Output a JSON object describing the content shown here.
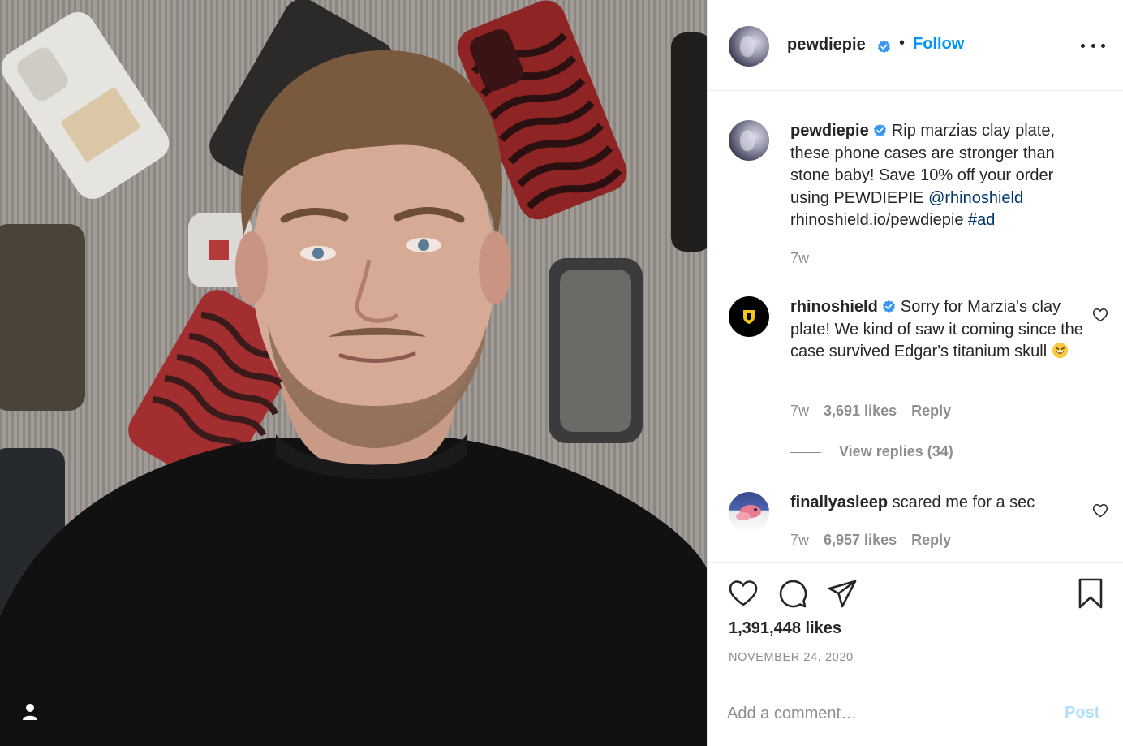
{
  "post": {
    "username": "pewdiepie",
    "follow_label": "Follow",
    "separator": "•",
    "more_icon": "more-options-icon"
  },
  "caption": {
    "username": "pewdiepie",
    "text_before": "Rip marzias clay plate, these phone cases are stronger than stone baby! Save 10% off your order using PEWDIEPIE ",
    "mention": "@rhinoshield",
    "text_after": " rhinoshield.io/pewdiepie ",
    "hashtag": "#ad",
    "time": "7w"
  },
  "comments": [
    {
      "username": "rhinoshield",
      "text": "Sorry for Marzia's clay plate! We kind of saw it coming since the case survived Edgar's titanium skull",
      "time": "7w",
      "likes": "3,691 likes",
      "reply_label": "Reply",
      "view_replies": "View replies (34)"
    },
    {
      "username": "finallyasleep",
      "text": "scared me for a sec",
      "time": "7w",
      "likes": "6,957 likes",
      "reply_label": "Reply"
    }
  ],
  "actions": {
    "likes": "1,391,448 likes",
    "date": "NOVEMBER 24, 2020"
  },
  "add_comment": {
    "placeholder": "Add a comment…",
    "post_label": "Post"
  },
  "colors": {
    "accent": "#0095f6",
    "link": "#00376b",
    "muted": "#8e8e8e",
    "post_disabled": "#b2dffc"
  }
}
